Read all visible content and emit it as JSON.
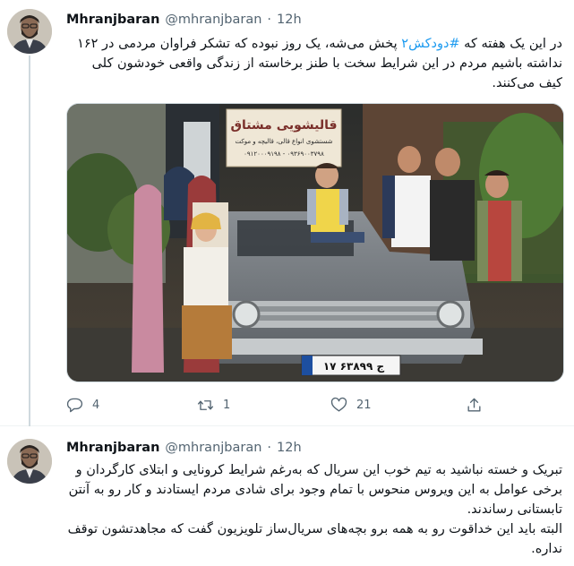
{
  "tweets": [
    {
      "name": "Mhranjbaran",
      "handle": "@mhranjbaran",
      "dot": "·",
      "time": "12h",
      "text_before": "در این یک هفته که ",
      "hashtag": "#دودکش۲",
      "text_after": " پخش می‌شه، یک روز نبوده که تشکر فراوان مردمی در ۱۶۲ نداشته باشیم مردم در این شرایط سخت با طنز برخاسته از زندگی واقعی خودشون کلی کیف می‌کنند.",
      "plate": "۱۷ ج ۶۳۸۹۹",
      "shop_sign_title": "قالیشویی مشتاق",
      "shop_sign_line": "شستشوی انواع قالی، قالیچه و موکت",
      "shop_sign_phone": "۰۹۱۲۰۰۰۹۱۹۸ - ۰۹۳۶۹۰۰۳۷۹۸",
      "actions": {
        "replies": "4",
        "retweets": "1",
        "likes": "21"
      }
    },
    {
      "name": "Mhranjbaran",
      "handle": "@mhranjbaran",
      "dot": "·",
      "time": "12h",
      "paragraph1": "تبریک و خسته نباشید به تیم خوب این سریال که به‌رغم شرایط کرونایی و ابتلای کارگردان و برخی عوامل به این ویروس منحوس با تمام وجود برای شادی مردم ایستادند و کار رو به آنتن تابستانی رساندند.",
      "paragraph2": "البته باید این خداقوت رو به همه برو بچه‌های سریال‌ساز تلویزیون گفت که مجاهدتشون توقف نداره."
    }
  ],
  "colors": {
    "accent": "#1d9bf0",
    "text": "#0f1419",
    "muted": "#536471",
    "border": "#cfd9de"
  },
  "icons": [
    "reply-icon",
    "retweet-icon",
    "like-icon",
    "share-icon"
  ]
}
